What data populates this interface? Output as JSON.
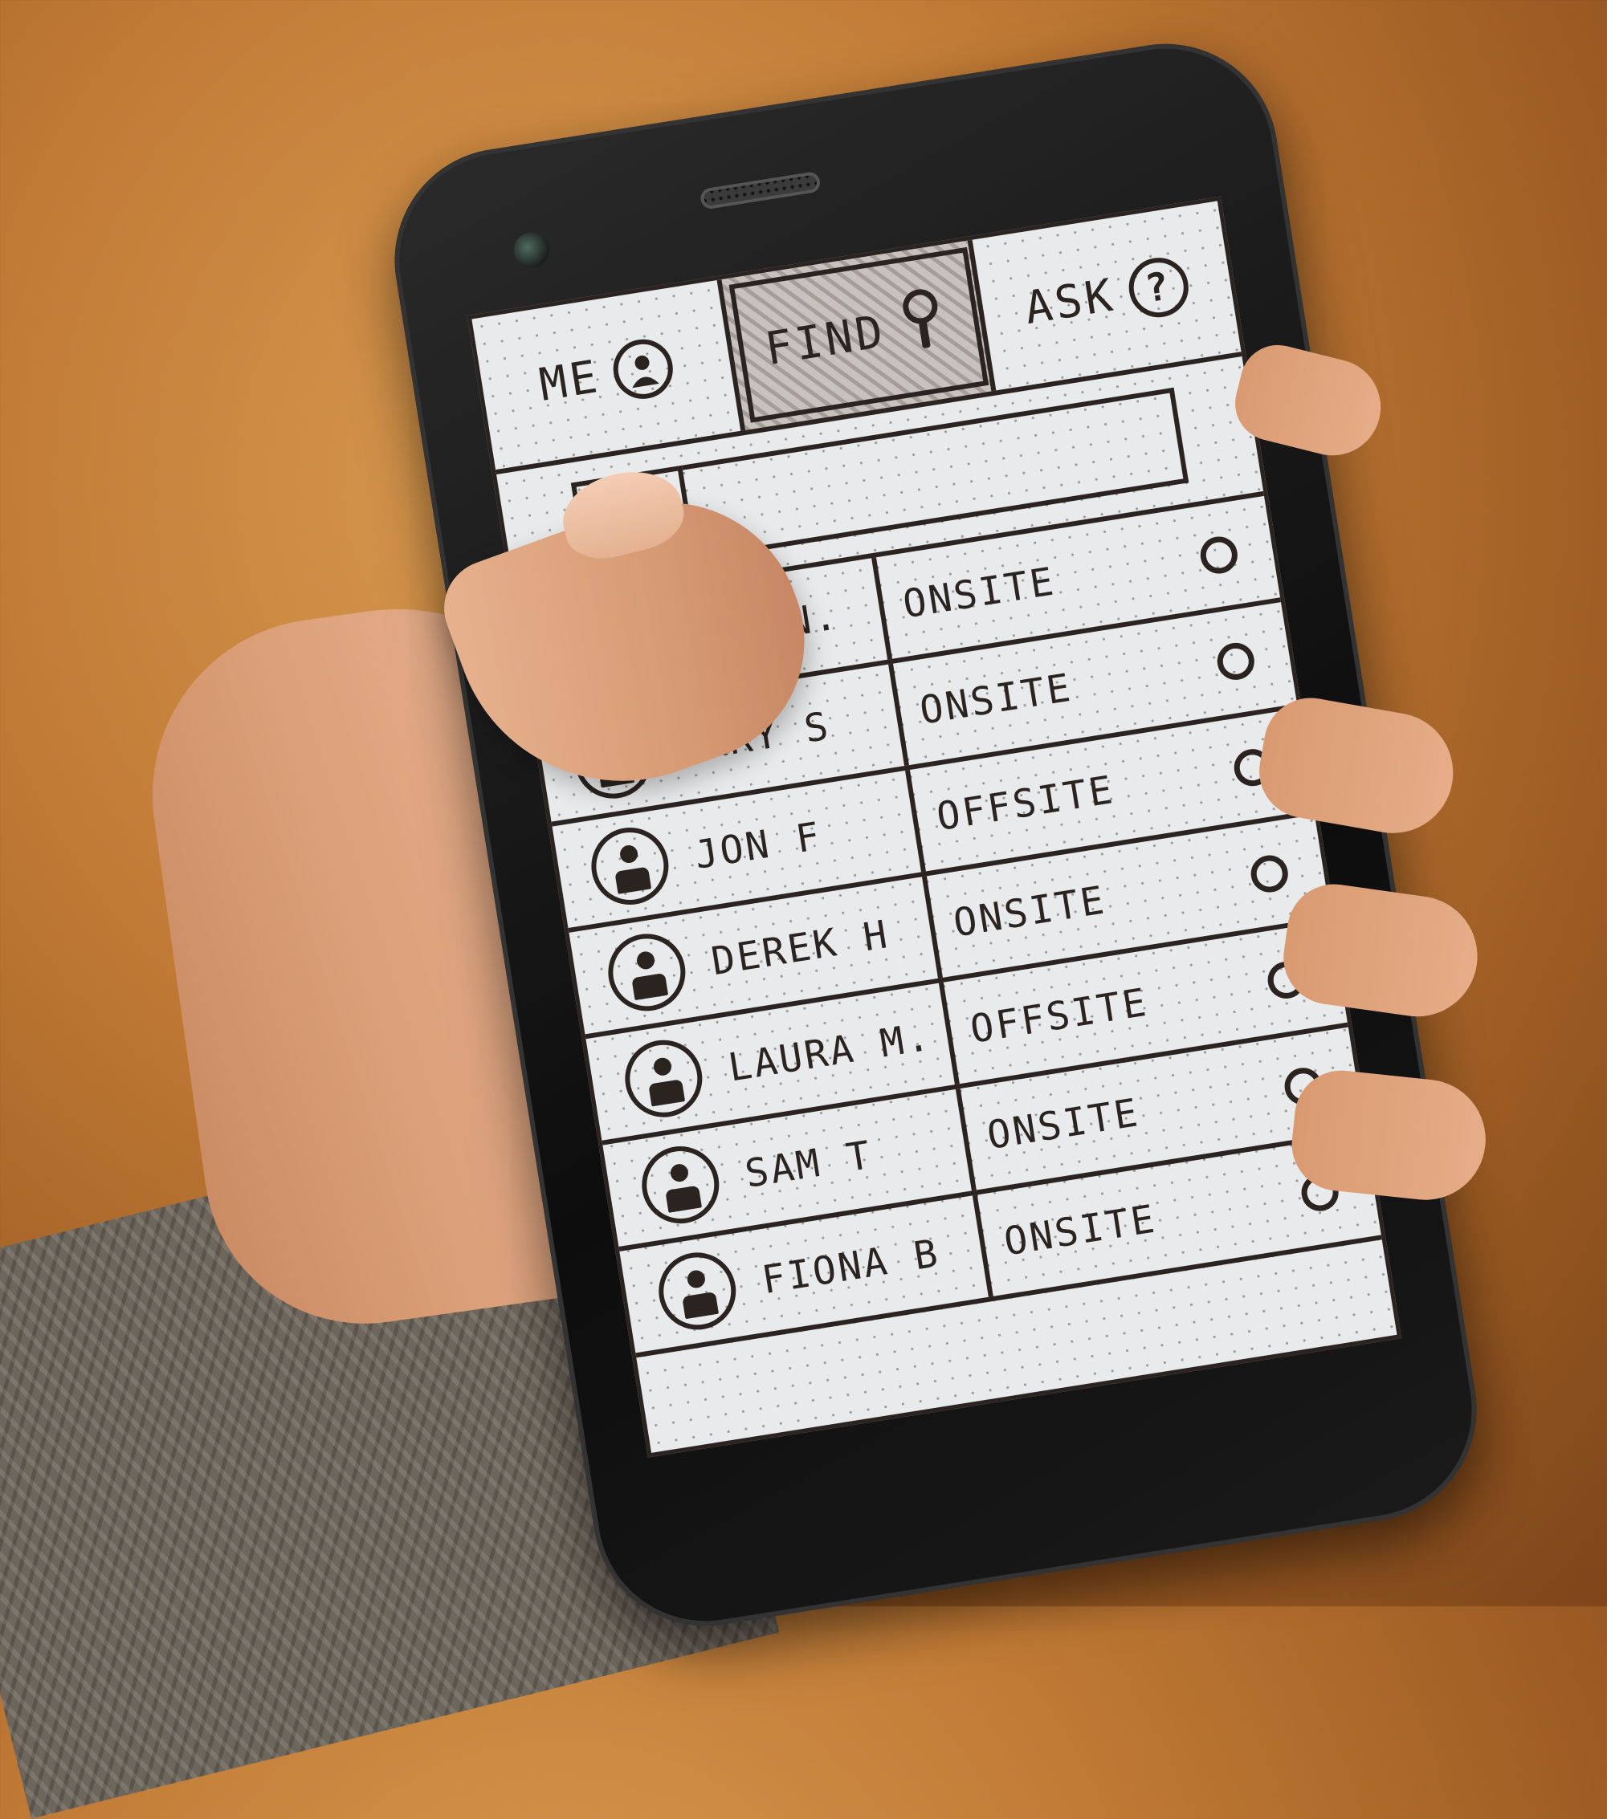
{
  "tabs": [
    {
      "label": "ME",
      "icon": "user-icon",
      "active": false
    },
    {
      "label": "FIND",
      "icon": "magnifier-icon",
      "active": true
    },
    {
      "label": "ASK",
      "icon": "question-icon",
      "active": false
    }
  ],
  "search": {
    "icon": "magnifier-icon",
    "value": ""
  },
  "people": [
    {
      "name": "PAUL N.",
      "status": "ONSITE"
    },
    {
      "name": "MARY S",
      "status": "ONSITE"
    },
    {
      "name": "JON F",
      "status": "OFFSITE"
    },
    {
      "name": "DEREK H",
      "status": "ONSITE"
    },
    {
      "name": "LAURA M.",
      "status": "OFFSITE"
    },
    {
      "name": "SAM T",
      "status": "ONSITE"
    },
    {
      "name": "FIONA B",
      "status": "ONSITE"
    }
  ],
  "colors": {
    "ink": "#2a2320",
    "paper": "#e9eaeb",
    "background": "#c17a35"
  }
}
